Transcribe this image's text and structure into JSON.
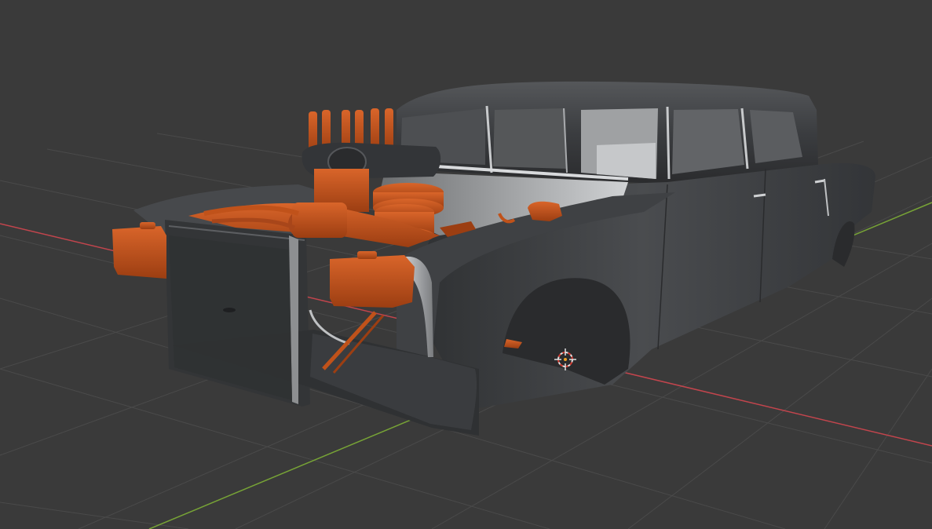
{
  "viewport": {
    "background": "#3a3a3a",
    "grid_color": "#4a4a4a",
    "x_axis_color": "#c2454d",
    "y_axis_color": "#77a336"
  },
  "model": {
    "body_color": "#3d3f42",
    "body_highlight": "#6b6d70",
    "engine_color": "#c0521a",
    "engine_shadow": "#7e3210",
    "chrome_color": "#b9bcbf",
    "interior_color": "#8d8f91"
  },
  "icons": {
    "cursor": "3d-cursor-icon"
  }
}
